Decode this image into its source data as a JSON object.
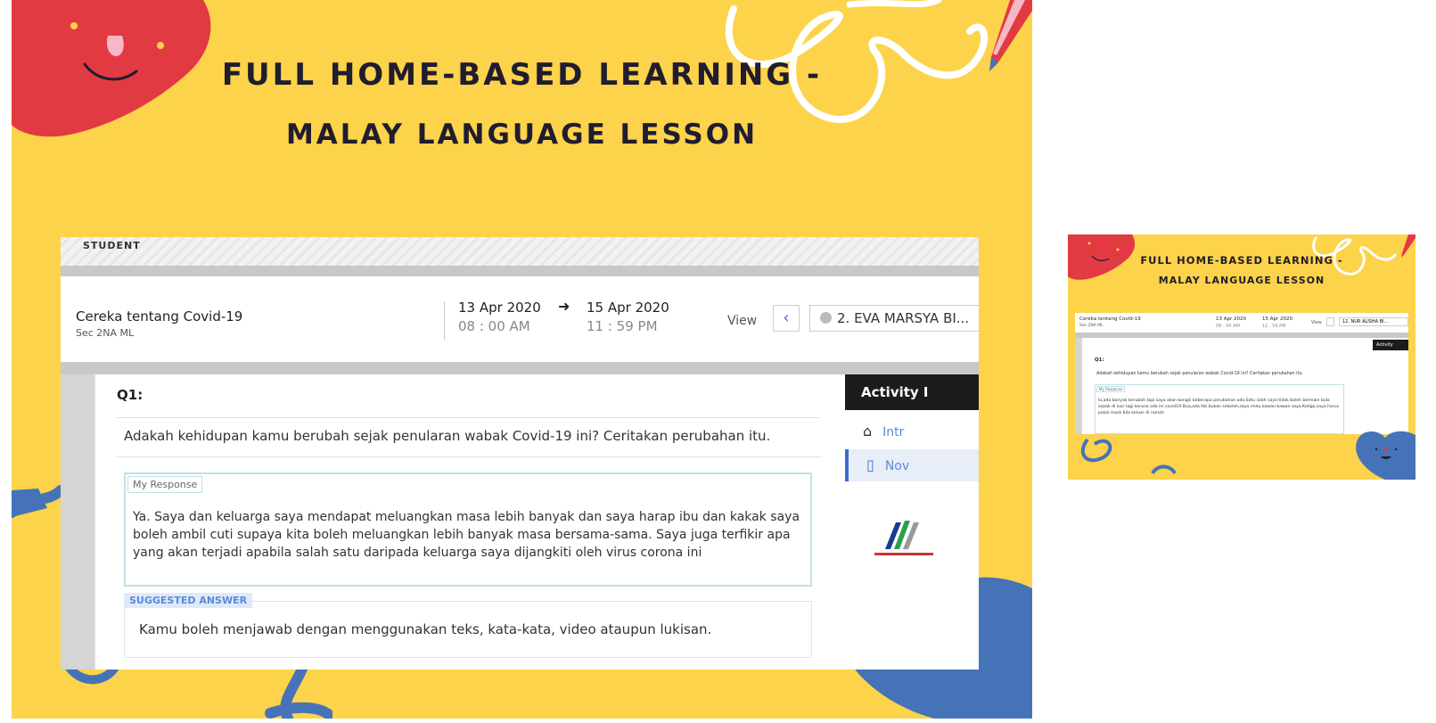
{
  "slide": {
    "title_line1": "FULL HOME-BASED LEARNING -",
    "title_line2": "MALAY LANGUAGE LESSON"
  },
  "app": {
    "logo_text": "STUDENT",
    "lesson_title": "Cereka tentang Covid-19",
    "lesson_class": "Sec 2NA ML",
    "start_date": "13 Apr 2020",
    "start_time": "08 : 00 AM",
    "end_date": "15 Apr 2020",
    "end_time": "11 : 59 PM",
    "view_label": "View",
    "prev_icon": "‹",
    "student_name": "2. EVA MARSYA BI..."
  },
  "question": {
    "label": "Q1:",
    "text": "Adakah kehidupan kamu berubah sejak penularan wabak Covid-19 ini? Ceritakan perubahan itu.",
    "response_label": "My Response",
    "response_text": "Ya. Saya dan keluarga saya mendapat meluangkan masa lebih banyak dan saya harap ibu dan kakak saya boleh ambil cuti supaya kita boleh meluangkan lebih banyak masa bersama-sama. Saya juga terfikir apa yang akan terjadi apabila salah satu daripada keluarga saya dijangkiti oleh virus corona ini",
    "suggested_label": "SUGGESTED ANSWER",
    "suggested_text": "Kamu boleh menjawab dengan menggunakan teks, kata-kata, video ataupun lukisan."
  },
  "activity": {
    "header": "Activity I",
    "items": [
      {
        "icon": "home-icon",
        "label": "Intr"
      },
      {
        "icon": "document-icon",
        "label": "Nov"
      }
    ]
  },
  "thumbnail": {
    "title_line1": "FULL HOME-BASED LEARNING -",
    "title_line2": "MALAY LANGUAGE LESSON",
    "lesson_title": "Cereka tentang Covid-19",
    "lesson_class": "Sec 2NA ML",
    "start_date": "13 Apr 2020",
    "start_time": "08 : 00 AM",
    "end_date": "15 Apr 2020",
    "end_time": "11 : 59 PM",
    "view_label": "View",
    "student_name": "12. NUR ALISHA BI...",
    "activity_header": "Activity",
    "q_label": "Q1:",
    "q_text": "Adakah kehidupan kamu berubah sejak penularan wabak Covid-19 ini? Ceritakan perubahan itu.",
    "response_label": "My Response",
    "response_text": "Ia,ada banyak berubah tapi saya akan kongsi beberapa perubahan ada.Satu ialah saya tidak boleh bermain bola sepak di luar lagi kerana ada ini covid19.Dua,ada hbi bukan sekolah,saya rindu kawan-kawan saya.Ketiga,saya harus pakai mask bila keluar di rumah"
  },
  "colors": {
    "background_yellow": "#fcd34a",
    "blob_red": "#e23a43",
    "blob_blue": "#4673b8",
    "accent_blue": "#3a6bd8"
  }
}
